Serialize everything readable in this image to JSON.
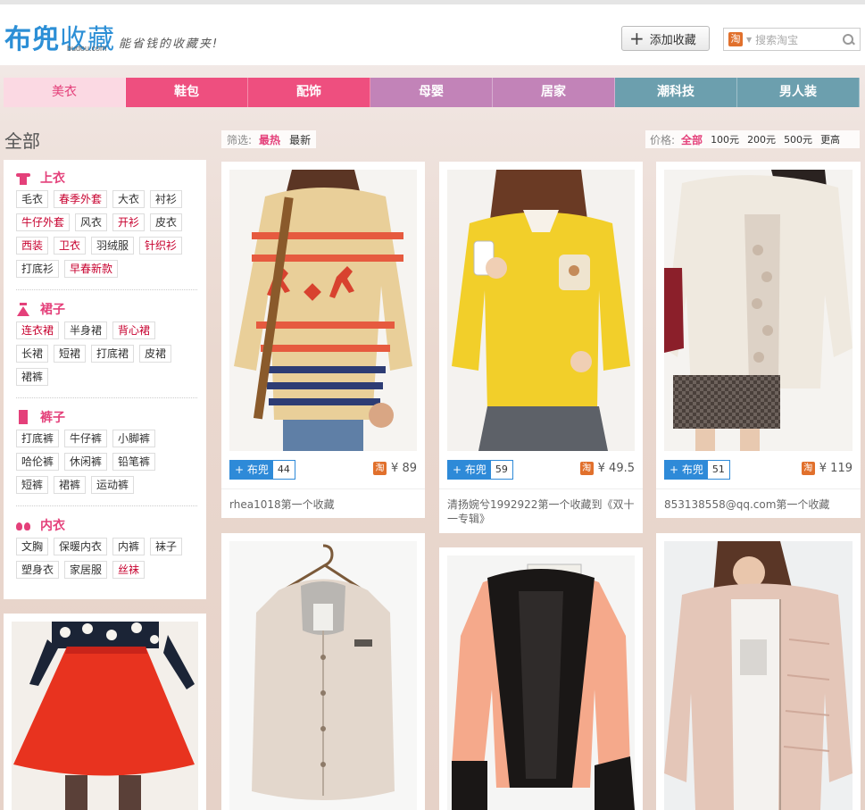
{
  "header": {
    "logo_main": "布兜",
    "logo_sub": "收藏",
    "logo_domain": "budou.com",
    "slogan": "能省钱的收藏夹!",
    "add_button": "添加收藏",
    "search_placeholder": "搜索淘宝",
    "search_source_icon": "淘"
  },
  "nav": {
    "tabs": [
      {
        "label": "美衣",
        "active": true
      },
      {
        "label": "鞋包"
      },
      {
        "label": "配饰"
      },
      {
        "label": "母婴"
      },
      {
        "label": "居家"
      },
      {
        "label": "潮科技"
      },
      {
        "label": "男人装"
      }
    ],
    "colors": {
      "pink": "#ee4f7f",
      "purple": "#c283b8",
      "teal": "#6c9fae",
      "active_bg": "#fbd9e3"
    }
  },
  "page_title": "全部",
  "filter": {
    "label": "筛选:",
    "options": [
      "最热",
      "最新"
    ],
    "active": "最热"
  },
  "price_filter": {
    "label": "价格:",
    "options": [
      "全部",
      "100元",
      "200元",
      "500元",
      "更高"
    ],
    "active": "全部"
  },
  "sidebar": {
    "categories": [
      {
        "name": "上衣",
        "icon": "shirt-icon",
        "tags": [
          {
            "t": "毛衣"
          },
          {
            "t": "春季外套",
            "hot": true
          },
          {
            "t": "大衣"
          },
          {
            "t": "衬衫"
          },
          {
            "t": "牛仔外套",
            "hot": true
          },
          {
            "t": "风衣"
          },
          {
            "t": "开衫",
            "hot": true
          },
          {
            "t": "皮衣"
          },
          {
            "t": "西装",
            "hot": true
          },
          {
            "t": "卫衣",
            "hot": true
          },
          {
            "t": "羽绒服"
          },
          {
            "t": "针织衫",
            "hot": true
          },
          {
            "t": "打底衫"
          },
          {
            "t": "早春新款",
            "hot": true
          }
        ]
      },
      {
        "name": "裙子",
        "icon": "skirt-icon",
        "tags": [
          {
            "t": "连衣裙",
            "hot": true
          },
          {
            "t": "半身裙"
          },
          {
            "t": "背心裙",
            "hot": true
          },
          {
            "t": "长裙"
          },
          {
            "t": "短裙"
          },
          {
            "t": "打底裙"
          },
          {
            "t": "皮裙"
          },
          {
            "t": "裙裤"
          }
        ]
      },
      {
        "name": "裤子",
        "icon": "pants-icon",
        "tags": [
          {
            "t": "打底裤"
          },
          {
            "t": "牛仔裤"
          },
          {
            "t": "小脚裤"
          },
          {
            "t": "哈伦裤"
          },
          {
            "t": "休闲裤"
          },
          {
            "t": "铅笔裤"
          },
          {
            "t": "短裤"
          },
          {
            "t": "裙裤"
          },
          {
            "t": "运动裤"
          }
        ]
      },
      {
        "name": "内衣",
        "icon": "underwear-icon",
        "tags": [
          {
            "t": "文胸"
          },
          {
            "t": "保暖内衣"
          },
          {
            "t": "内裤"
          },
          {
            "t": "袜子"
          },
          {
            "t": "塑身衣"
          },
          {
            "t": "家居服"
          },
          {
            "t": "丝袜",
            "hot": true
          }
        ]
      }
    ]
  },
  "products": [
    {
      "id": "sweater-deer",
      "btn": "布兜",
      "count": "44",
      "price": "¥ 89",
      "caption": "rhea1018第一个收藏"
    },
    {
      "id": "yellow-sweater",
      "btn": "布兜",
      "count": "59",
      "price": "¥ 49.5",
      "caption": "清扬婉兮1992922第一个收藏到《双十一专辑》"
    },
    {
      "id": "white-cardigan",
      "btn": "布兜",
      "count": "51",
      "price": "¥ 119",
      "caption": "853138558@qq.com第一个收藏"
    },
    {
      "id": "red-skirt"
    },
    {
      "id": "beige-vest"
    },
    {
      "id": "orange-fur-jacket"
    },
    {
      "id": "pink-down-jacket"
    }
  ],
  "price_icon": "淘"
}
